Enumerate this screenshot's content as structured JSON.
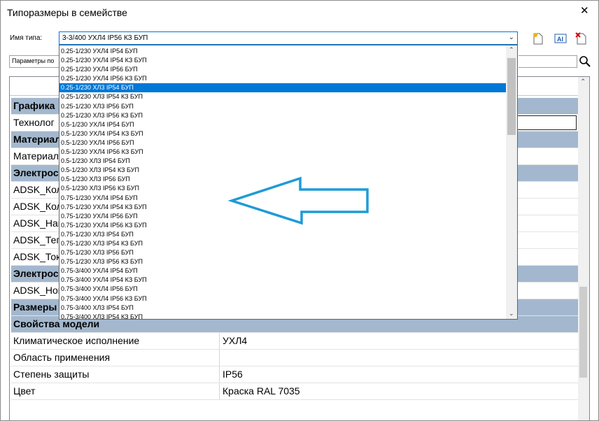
{
  "window": {
    "title": "Типоразмеры в семействе",
    "close_glyph": "✕"
  },
  "type_name": {
    "label": "Имя типа:",
    "value": "3-3/400 УХЛ4 IP56 КЗ БУП"
  },
  "toolbar": {
    "buttons": [
      "new-type-icon",
      "rename-type-icon",
      "delete-type-icon"
    ]
  },
  "params_filter": {
    "value": "Параметры по"
  },
  "dropdown": {
    "selected_index": 4,
    "items": [
      "0.25-1/230 УХЛ4 IP54 БУП",
      "0.25-1/230 УХЛ4 IP54 КЗ БУП",
      "0.25-1/230 УХЛ4 IP56 БУП",
      "0.25-1/230 УХЛ4 IP56 КЗ БУП",
      "0.25-1/230 ХЛ3 IP54 БУП",
      "0.25-1/230 ХЛ3 IP54 КЗ БУП",
      "0.25-1/230 ХЛ3 IP56 БУП",
      "0.25-1/230 ХЛ3 IP56 КЗ БУП",
      "0.5-1/230 УХЛ4 IP54 БУП",
      "0.5-1/230 УХЛ4 IP54 КЗ БУП",
      "0.5-1/230 УХЛ4 IP56 БУП",
      "0.5-1/230 УХЛ4 IP56 КЗ БУП",
      "0.5-1/230 ХЛ3 IP54 БУП",
      "0.5-1/230 ХЛ3 IP54 КЗ БУП",
      "0.5-1/230 ХЛ3 IP56 БУП",
      "0.5-1/230 ХЛ3 IP56 КЗ БУП",
      "0.75-1/230 УХЛ4 IP54 БУП",
      "0.75-1/230 УХЛ4 IP54 КЗ БУП",
      "0.75-1/230 УХЛ4 IP56 БУП",
      "0.75-1/230 УХЛ4 IP56 КЗ БУП",
      "0.75-1/230 ХЛ3 IP54 БУП",
      "0.75-1/230 ХЛ3 IP54 КЗ БУП",
      "0.75-1/230 ХЛ3 IP56 БУП",
      "0.75-1/230 ХЛ3 IP56 КЗ БУП",
      "0.75-3/400 УХЛ4 IP54 БУП",
      "0.75-3/400 УХЛ4 IP54 КЗ БУП",
      "0.75-3/400 УХЛ4 IP56 БУП",
      "0.75-3/400 УХЛ4 IP56 КЗ БУП",
      "0.75-3/400 ХЛ3 IP54 БУП",
      "0.75-3/400 ХЛ3 IP54 КЗ БУП"
    ]
  },
  "grid": {
    "rows": [
      {
        "kind": "group",
        "label": "Графика"
      },
      {
        "kind": "param",
        "name": "Технолог",
        "value": "",
        "edit": true
      },
      {
        "kind": "group",
        "label": "Материал"
      },
      {
        "kind": "param",
        "name": "Материал",
        "value": ""
      },
      {
        "kind": "group",
        "label": "Электрос"
      },
      {
        "kind": "param",
        "name": "ADSK_Кол",
        "value": ""
      },
      {
        "kind": "param",
        "name": "ADSK_Кол",
        "value": ""
      },
      {
        "kind": "param",
        "name": "ADSK_Наг",
        "value": ""
      },
      {
        "kind": "param",
        "name": "ADSK_Тег",
        "value": ""
      },
      {
        "kind": "param",
        "name": "ADSK_Ток",
        "value": ""
      },
      {
        "kind": "group",
        "label": "Электрос"
      },
      {
        "kind": "param",
        "name": "ADSK_Ног",
        "value": ""
      },
      {
        "kind": "group",
        "label": "Размеры"
      },
      {
        "kind": "group",
        "label": "Свойства модели"
      },
      {
        "kind": "param",
        "name": "Климатическое исполнение",
        "value": "УХЛ4"
      },
      {
        "kind": "param",
        "name": "Область применения",
        "value": ""
      },
      {
        "kind": "param",
        "name": "Степень защиты",
        "value": "IP56"
      },
      {
        "kind": "param",
        "name": "Цвет",
        "value": "Краска RAL 7035"
      }
    ]
  },
  "colors": {
    "group_header": "#a3b8ce",
    "selection": "#0078d7",
    "annotation_arrow": "#1e9bd7"
  }
}
